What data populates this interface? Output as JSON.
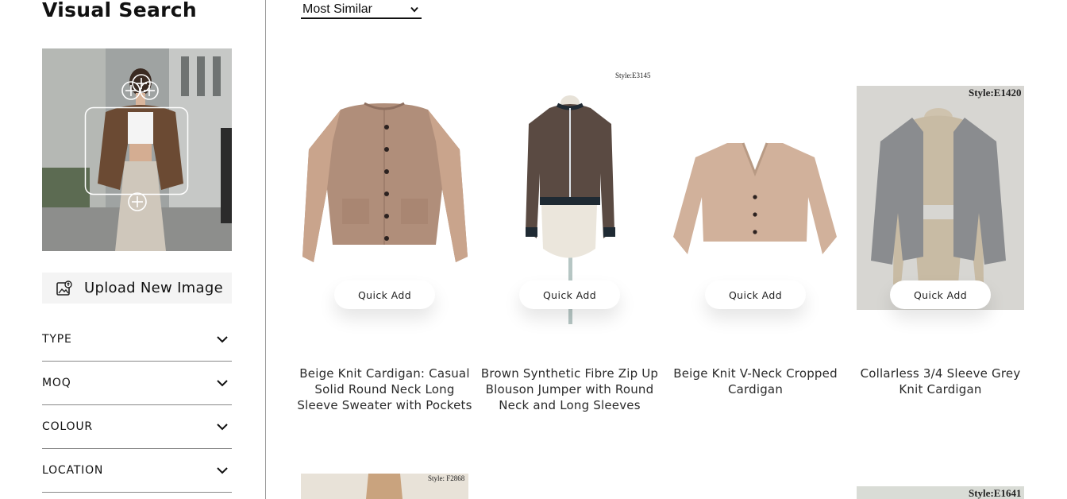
{
  "sidebar": {
    "title": "Visual Search",
    "upload_label": "Upload New Image",
    "filters": [
      {
        "label": "TYPE"
      },
      {
        "label": "MOQ"
      },
      {
        "label": "COLOUR"
      },
      {
        "label": "LOCATION"
      }
    ]
  },
  "sort": {
    "selected": "Most Similar"
  },
  "products": [
    {
      "name": "Beige Knit Cardigan: Casual Solid Round Neck Long Sleeve Sweater with Pockets",
      "quick_add": "Quick Add",
      "style": ""
    },
    {
      "name": "Brown Synthetic Fibre Zip Up Blouson Jumper with Round Neck and Long Sleeves",
      "quick_add": "Quick Add",
      "style": "Style:E3145"
    },
    {
      "name": "Beige Knit V-Neck Cropped Cardigan",
      "quick_add": "Quick Add",
      "style": ""
    },
    {
      "name": "Collarless 3/4 Sleeve Grey Knit Cardigan",
      "quick_add": "Quick Add",
      "style": "Style:E1420"
    }
  ],
  "second_row": [
    {
      "style": "Style: F2868"
    },
    {
      "style": ""
    },
    {
      "style": ""
    },
    {
      "style": "Style:E1641"
    }
  ],
  "colors": {
    "sidebar_border": "#9a9a9a",
    "upload_bg": "#f4f4f4",
    "beige": "#c9a48c",
    "brown_jacket": "#5a4a42",
    "grey_cardigan": "#8a8c8f"
  }
}
